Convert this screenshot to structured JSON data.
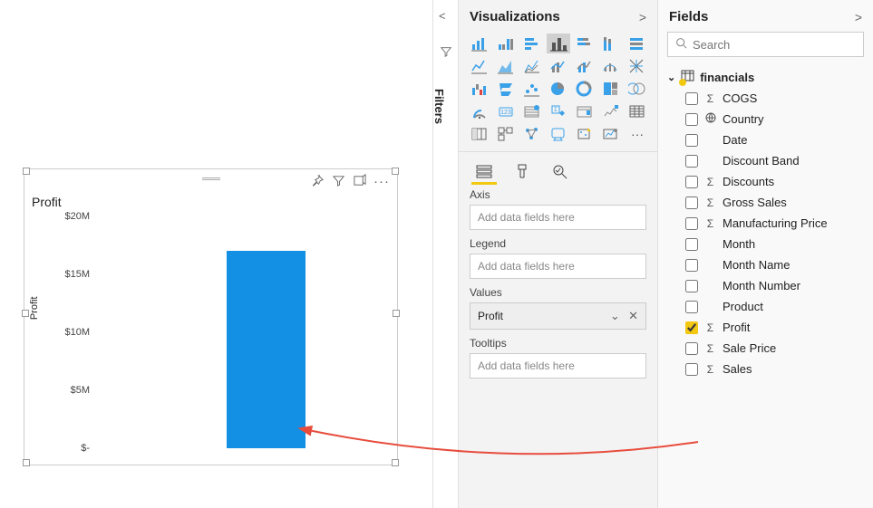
{
  "canvas": {
    "chart": {
      "title": "Profit",
      "y_axis_label": "Profit",
      "y_ticks": [
        "$20M",
        "$15M",
        "$10M",
        "$5M",
        "$-"
      ]
    }
  },
  "filters": {
    "label": "Filters"
  },
  "visualizations": {
    "title": "Visualizations",
    "wells": {
      "axis": {
        "label": "Axis",
        "placeholder": "Add data fields here"
      },
      "legend": {
        "label": "Legend",
        "placeholder": "Add data fields here"
      },
      "values": {
        "label": "Values",
        "value": "Profit"
      },
      "tooltips": {
        "label": "Tooltips",
        "placeholder": "Add data fields here"
      }
    }
  },
  "fields": {
    "title": "Fields",
    "search_placeholder": "Search",
    "table": "financials",
    "items": [
      {
        "name": "COGS",
        "icon": "sigma",
        "checked": false
      },
      {
        "name": "Country",
        "icon": "globe",
        "checked": false
      },
      {
        "name": "Date",
        "icon": "",
        "checked": false
      },
      {
        "name": "Discount Band",
        "icon": "",
        "checked": false
      },
      {
        "name": "Discounts",
        "icon": "sigma",
        "checked": false
      },
      {
        "name": "Gross Sales",
        "icon": "sigma",
        "checked": false
      },
      {
        "name": "Manufacturing Price",
        "icon": "sigma",
        "checked": false
      },
      {
        "name": "Month",
        "icon": "",
        "checked": false
      },
      {
        "name": "Month Name",
        "icon": "",
        "checked": false
      },
      {
        "name": "Month Number",
        "icon": "",
        "checked": false
      },
      {
        "name": "Product",
        "icon": "",
        "checked": false
      },
      {
        "name": "Profit",
        "icon": "sigma",
        "checked": true
      },
      {
        "name": "Sale Price",
        "icon": "sigma",
        "checked": false
      },
      {
        "name": "Sales",
        "icon": "sigma",
        "checked": false
      }
    ]
  },
  "chart_data": {
    "type": "bar",
    "categories": [
      ""
    ],
    "values": [
      17
    ],
    "title": "Profit",
    "xlabel": "",
    "ylabel": "Profit",
    "ylim": [
      0,
      20
    ],
    "y_tick_values": [
      0,
      5,
      10,
      15,
      20
    ],
    "y_tick_labels": [
      "$-",
      "$5M",
      "$10M",
      "$15M",
      "$20M"
    ],
    "unit": "$M"
  }
}
